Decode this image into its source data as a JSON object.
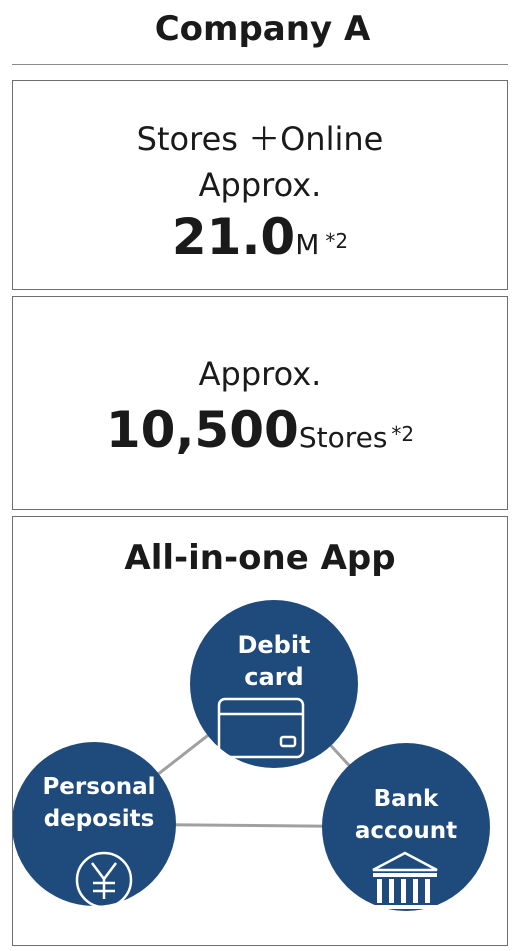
{
  "header": {
    "title": "Company A"
  },
  "members_panel": {
    "line1": "Stores ＋Online",
    "line2": "Approx.",
    "value": "21.0",
    "unit": "M",
    "footnote": "*2"
  },
  "stores_panel": {
    "line1": "Approx.",
    "value": "10,500",
    "unit": "Stores",
    "footnote": "*2"
  },
  "app_panel": {
    "heading": "All-in-one App",
    "nodes": {
      "debit": {
        "line1": "Debit",
        "line2": "card",
        "icon": "credit-card-icon"
      },
      "personal": {
        "line1": "Personal",
        "line2": "deposits",
        "icon": "yen-icon"
      },
      "bank": {
        "line1": "Bank",
        "line2": "account",
        "icon": "bank-building-icon"
      }
    },
    "colors": {
      "node_fill": "#1f4a7c",
      "connector": "#a0a0a0"
    }
  }
}
